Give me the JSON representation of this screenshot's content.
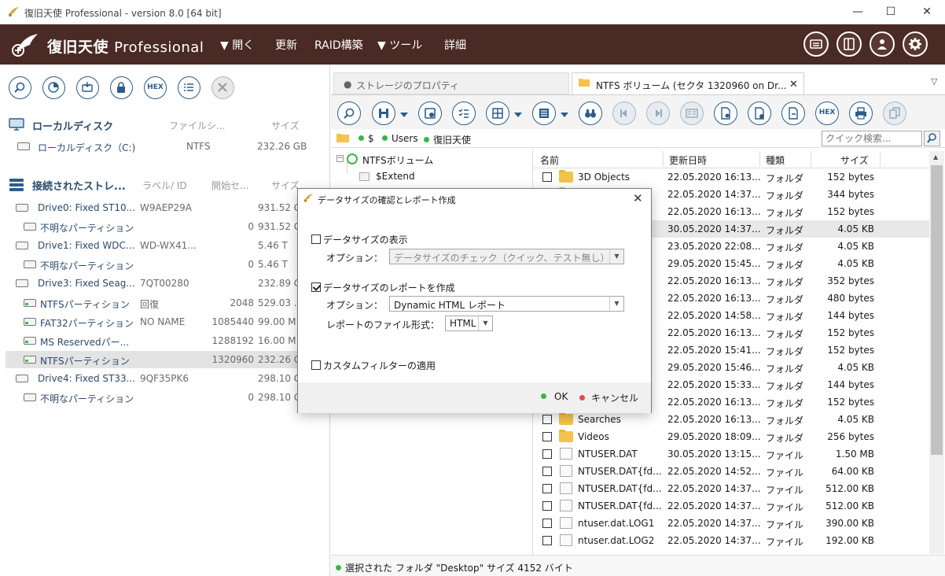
{
  "window": {
    "title": "復旧天使 Professional - version 8.0 [64 bit]",
    "minimize": "—",
    "maximize": "☐",
    "close": "✕"
  },
  "menubar": {
    "brand_name": "復旧天使",
    "brand_suffix": "Professional",
    "items": [
      "▼ 開く",
      "更新",
      "RAID構築",
      "▼ ツール",
      "詳細"
    ],
    "right_icons": [
      "drive-list-icon",
      "panel-layout-icon",
      "user-icon",
      "gear-icon"
    ]
  },
  "left_toolbar": {
    "icons": [
      "search-icon",
      "scan-icon",
      "image-drive-icon",
      "lock-icon",
      "hex-icon",
      "list-icon",
      "close-icon"
    ],
    "hex_label": "HEX"
  },
  "local_disks": {
    "title": "ローカルディスク",
    "col_fs": "ファイルシ...",
    "col_size": "サイズ",
    "items": [
      {
        "name": "ローカルディスク（C:)",
        "fs": "NTFS",
        "size": "232.26 GB"
      }
    ]
  },
  "connected": {
    "title": "接続されたストレ...",
    "col_label": "ラベル/ ID",
    "col_start": "開始セ...",
    "col_size": "サイズ",
    "items": [
      {
        "name": "Drive0: Fixed ST10...",
        "label": "W9AEP29A",
        "start": "",
        "size": "931.52 G",
        "level": 0
      },
      {
        "name": "不明なパーティション",
        "label": "",
        "start": "0",
        "size": "931.52 G",
        "level": 1
      },
      {
        "name": "Drive1: Fixed WDC...",
        "label": "WD-WX41...",
        "start": "",
        "size": "5.46 T",
        "level": 0
      },
      {
        "name": "不明なパーティション",
        "label": "",
        "start": "0",
        "size": "5.46 T",
        "level": 1
      },
      {
        "name": "Drive3: Fixed Seag...",
        "label": "7QT00280",
        "start": "",
        "size": "232.89 G",
        "level": 0
      },
      {
        "name": "NTFSパーティション",
        "label": "回復",
        "start": "2048",
        "size": "529.03 ...",
        "level": 1
      },
      {
        "name": "FAT32パーティション",
        "label": "NO NAME",
        "start": "1085440",
        "size": "99.00 M",
        "level": 1
      },
      {
        "name": "MS Reservedパー...",
        "label": "",
        "start": "1288192",
        "size": "16.00 M",
        "level": 1
      },
      {
        "name": "NTFSパーティション",
        "label": "",
        "start": "1320960",
        "size": "232.26 G",
        "level": 1
      },
      {
        "name": "Drive4: Fixed ST33...",
        "label": "9QF35PK6",
        "start": "",
        "size": "298.10 G",
        "level": 0
      },
      {
        "name": "不明なパーティション",
        "label": "",
        "start": "0",
        "size": "298.10 G",
        "level": 1
      }
    ]
  },
  "tabs": [
    {
      "label": "ストレージのプロパティ"
    },
    {
      "label": "NTFS ボリューム (セクタ 1320960 on Dr..."
    }
  ],
  "tab_menu": "▽",
  "path": {
    "segments": [
      "$",
      "Users",
      "復旧天使"
    ],
    "search_placeholder": "クイック検索..."
  },
  "tree": {
    "root": "NTFSボリューム",
    "child": "$Extend"
  },
  "list": {
    "headers": [
      "名前",
      "更新日時",
      "種類",
      "サイズ"
    ],
    "rows": [
      {
        "name": "3D Objects",
        "date": "22.05.2020 16:13...",
        "type": "フォルダ",
        "size": "152 bytes",
        "kind": "folder"
      },
      {
        "name": "",
        "date": "22.05.2020 14:37...",
        "type": "フォルダ",
        "size": "344 bytes",
        "kind": "folder"
      },
      {
        "name": "",
        "date": "22.05.2020 16:13...",
        "type": "フォルダ",
        "size": "152 bytes",
        "kind": "folder"
      },
      {
        "name": "",
        "date": "30.05.2020 14:37...",
        "type": "フォルダ",
        "size": "4.05 KB",
        "kind": "folder"
      },
      {
        "name": "",
        "date": "23.05.2020 22:08...",
        "type": "フォルダ",
        "size": "4.05 KB",
        "kind": "folder"
      },
      {
        "name": "",
        "date": "29.05.2020 15:45...",
        "type": "フォルダ",
        "size": "4.05 KB",
        "kind": "folder"
      },
      {
        "name": "",
        "date": "22.05.2020 16:13...",
        "type": "フォルダ",
        "size": "352 bytes",
        "kind": "folder"
      },
      {
        "name": "",
        "date": "22.05.2020 16:13...",
        "type": "フォルダ",
        "size": "480 bytes",
        "kind": "folder"
      },
      {
        "name": "",
        "date": "22.05.2020 14:58...",
        "type": "フォルダ",
        "size": "144 bytes",
        "kind": "folder"
      },
      {
        "name": "",
        "date": "22.05.2020 16:13...",
        "type": "フォルダ",
        "size": "152 bytes",
        "kind": "folder"
      },
      {
        "name": "",
        "date": "22.05.2020 15:41...",
        "type": "フォルダ",
        "size": "152 bytes",
        "kind": "folder"
      },
      {
        "name": "",
        "date": "29.05.2020 15:46...",
        "type": "フォルダ",
        "size": "4.05 KB",
        "kind": "folder"
      },
      {
        "name": "",
        "date": "22.05.2020 15:33...",
        "type": "フォルダ",
        "size": "144 bytes",
        "kind": "folder"
      },
      {
        "name": "",
        "date": "22.05.2020 16:13...",
        "type": "フォルダ",
        "size": "152 bytes",
        "kind": "folder"
      },
      {
        "name": "Searches",
        "date": "22.05.2020 16:13...",
        "type": "フォルダ",
        "size": "4.05 KB",
        "kind": "folder"
      },
      {
        "name": "Videos",
        "date": "29.05.2020 18:09...",
        "type": "フォルダ",
        "size": "256 bytes",
        "kind": "folder"
      },
      {
        "name": "NTUSER.DAT",
        "date": "30.05.2020 13:15...",
        "type": "ファイル",
        "size": "1.50 MB",
        "kind": "file"
      },
      {
        "name": "NTUSER.DAT{fd...",
        "date": "22.05.2020 14:52...",
        "type": "ファイル",
        "size": "64.00 KB",
        "kind": "file"
      },
      {
        "name": "NTUSER.DAT{fd...",
        "date": "22.05.2020 14:37...",
        "type": "ファイル",
        "size": "512.00 KB",
        "kind": "file"
      },
      {
        "name": "NTUSER.DAT{fd...",
        "date": "22.05.2020 14:37...",
        "type": "ファイル",
        "size": "512.00 KB",
        "kind": "file"
      },
      {
        "name": "ntuser.dat.LOG1",
        "date": "22.05.2020 14:37...",
        "type": "ファイル",
        "size": "390.00 KB",
        "kind": "file"
      },
      {
        "name": "ntuser.dat.LOG2",
        "date": "22.05.2020 14:37...",
        "type": "ファイル",
        "size": "192.00 KB",
        "kind": "file"
      }
    ]
  },
  "status": "選択された フォルダ \"Desktop\" サイズ 4152 バイト",
  "dialog": {
    "title": "データサイズの確認とレポート作成",
    "close": "✕",
    "show_size_label": "データサイズの表示",
    "show_size_checked": false,
    "option_label": "オプション：",
    "option1_value": "データサイズのチェック（クイック、テスト無し）",
    "report_label": "データサイズのレポートを作成",
    "report_checked": true,
    "option2_value": "Dynamic HTML レポート",
    "format_label": "レポートのファイル形式：",
    "format_value": "HTML",
    "filter_label": "カスタムフィルターの適用",
    "filter_checked": false,
    "ok": "OK",
    "cancel": "キャンセル"
  },
  "rtoolbar": {
    "hex_label": "HEX"
  },
  "colors": {
    "menubar_bg": "#4a2a24",
    "accent_blue": "#2b5d8a",
    "green": "#3bb54a",
    "red": "#e04a4a"
  }
}
